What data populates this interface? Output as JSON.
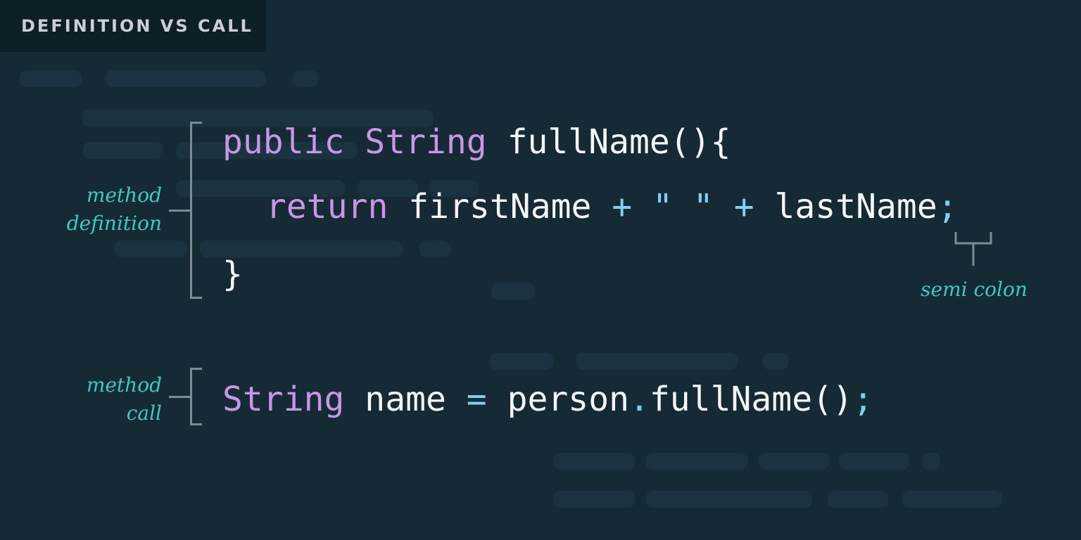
{
  "header": {
    "tag_label": "DEFINITION VS CALL"
  },
  "definition": {
    "label_line1": "method",
    "label_line2": "definition",
    "line1": {
      "kw1": "public",
      "kw2": "String",
      "signature": "fullName(){"
    },
    "line2": {
      "kw": "return",
      "var1": "firstName",
      "plus1": "+",
      "string": "\" \"",
      "plus2": "+",
      "var2": "lastName",
      "semicolon": ";"
    },
    "line3": {
      "close": "}"
    }
  },
  "semicolon_note": {
    "label": "semi colon"
  },
  "call": {
    "label_line1": "method",
    "label_line2": "call",
    "type": "String",
    "var": "name",
    "equals": "=",
    "object": "person",
    "dot": ".",
    "method": "fullName()",
    "semicolon": ";"
  },
  "colors": {
    "background": "#162a36",
    "keyword": "#c896e6",
    "operator": "#7fd0f0",
    "identifier": "#f4f6f8",
    "annotation": "#3ec9c1",
    "bracket": "#7e8b94"
  }
}
